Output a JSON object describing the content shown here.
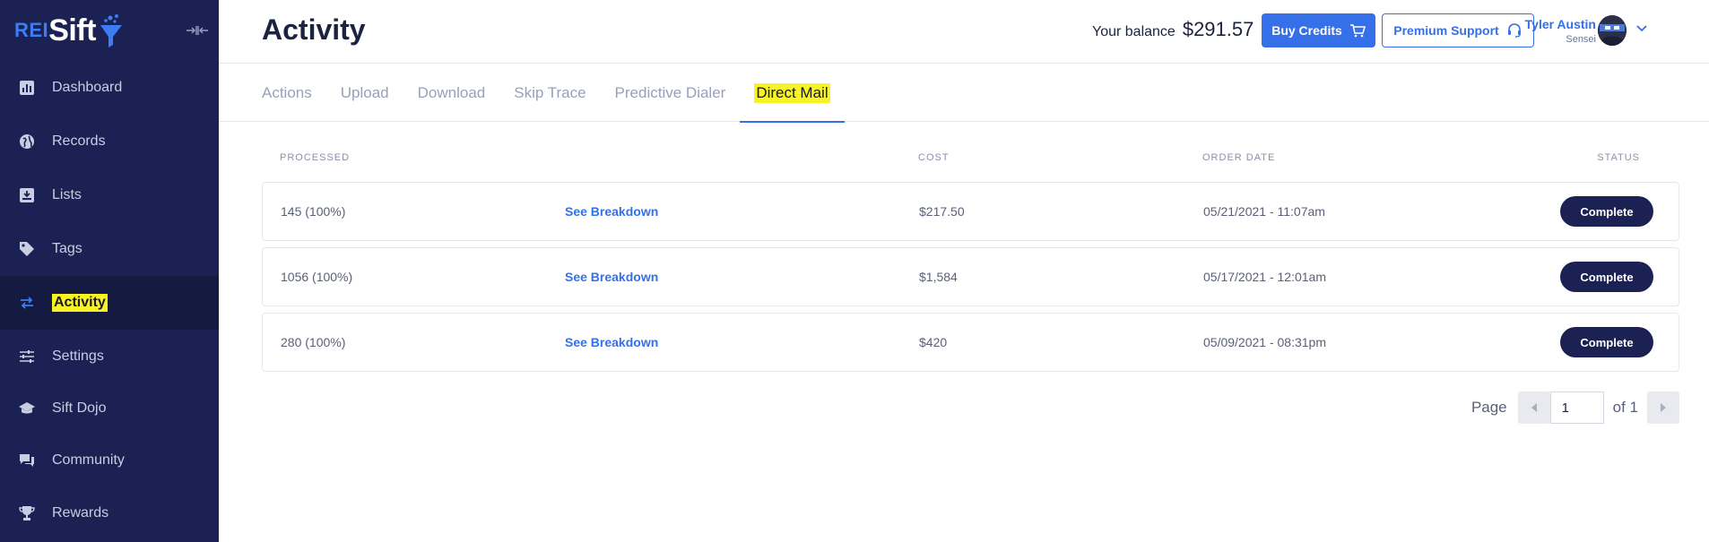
{
  "sidebar": {
    "logo": {
      "prefix": "REI",
      "name": "Sift"
    },
    "items": [
      {
        "label": "Dashboard",
        "icon": "chart-bar-icon"
      },
      {
        "label": "Records",
        "icon": "globe-icon"
      },
      {
        "label": "Lists",
        "icon": "inbox-download-icon"
      },
      {
        "label": "Tags",
        "icon": "tag-icon"
      },
      {
        "label": "Activity",
        "icon": "arrows-exchange-icon",
        "active": true
      },
      {
        "label": "Settings",
        "icon": "sliders-icon"
      },
      {
        "label": "Sift Dojo",
        "icon": "graduation-cap-icon"
      },
      {
        "label": "Community",
        "icon": "chat-bubbles-icon"
      },
      {
        "label": "Rewards",
        "icon": "trophy-icon"
      }
    ]
  },
  "header": {
    "title": "Activity",
    "balance_label": "Your balance",
    "balance_value": "$291.57",
    "buy_credits": "Buy Credits",
    "premium_support": "Premium Support",
    "user_name": "Tyler Austin",
    "user_role": "Sensei"
  },
  "tabs": [
    {
      "label": "Actions"
    },
    {
      "label": "Upload"
    },
    {
      "label": "Download"
    },
    {
      "label": "Skip Trace"
    },
    {
      "label": "Predictive Dialer"
    },
    {
      "label": "Direct Mail",
      "active": true
    }
  ],
  "table": {
    "columns": {
      "processed": "PROCESSED",
      "cost": "COST",
      "order_date": "ORDER DATE",
      "status": "STATUS"
    },
    "rows": [
      {
        "processed": "145 (100%)",
        "breakdown": "See Breakdown",
        "cost": "$217.50",
        "date": "05/21/2021 - 11:07am",
        "status": "Complete"
      },
      {
        "processed": "1056 (100%)",
        "breakdown": "See Breakdown",
        "cost": "$1,584",
        "date": "05/17/2021 - 12:01am",
        "status": "Complete"
      },
      {
        "processed": "280 (100%)",
        "breakdown": "See Breakdown",
        "cost": "$420",
        "date": "05/09/2021 - 08:31pm",
        "status": "Complete"
      }
    ]
  },
  "pagination": {
    "page_label": "Page",
    "current": "1",
    "of_label": "of 1"
  },
  "colors": {
    "sidebar_bg": "#1b2253",
    "accent": "#3570e8",
    "highlight": "#f7f324",
    "status_bg": "#1b2253"
  }
}
